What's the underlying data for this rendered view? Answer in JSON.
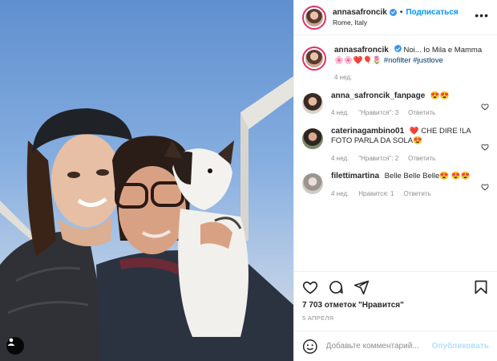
{
  "post": {
    "author": "annasafroncik",
    "follow_label": "Подписаться",
    "dot": "•",
    "location": "Rome, Italy",
    "more_label": "•••",
    "caption": {
      "author": "annasafroncik",
      "text": "Noi... Io Mila e Mamma 🌸🌸❤️🎈🌷",
      "hashtags": [
        "#nofilter",
        "#justlove"
      ],
      "time": "4 нед."
    }
  },
  "comments": [
    {
      "user": "anna_safroncik_fanpage",
      "text": "😍😍",
      "time": "4 нед.",
      "likes": "\"Нравится\": 3",
      "reply": "Ответить"
    },
    {
      "user": "caterinagambino01",
      "text": "❤️ CHE DIRE !LA FOTO PARLA DA SOLA😍",
      "time": "4 нед.",
      "likes": "\"Нравится\": 2",
      "reply": "Ответить"
    },
    {
      "user": "filettimartina",
      "text": "Belle Belle Belle😍 😍😍",
      "time": "4 нед.",
      "likes": "Нравится: 1",
      "reply": "Ответить"
    }
  ],
  "stats": {
    "likes": "7 703 отметок \"Нравится\"",
    "date": "5 апреля"
  },
  "add_comment": {
    "placeholder": "Добавьте комментарий...",
    "publish": "Опубликовать"
  },
  "colors": {
    "accent": "#0095f6",
    "verified": "#3897f0",
    "muted": "#8e8e8e",
    "border": "#efefef"
  },
  "icons": [
    "user-tag-icon",
    "verified-icon",
    "more-icon",
    "heart-icon",
    "comment-icon",
    "share-icon",
    "bookmark-icon",
    "emoji-icon"
  ]
}
